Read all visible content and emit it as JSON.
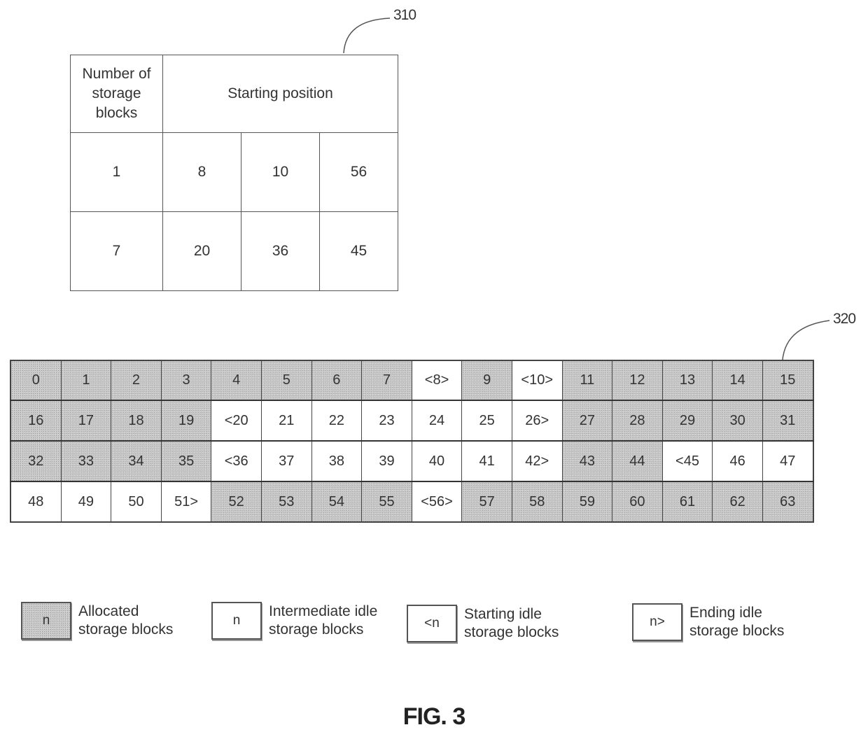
{
  "figure": {
    "caption": "FIG. 3",
    "ref_table": "310",
    "ref_grid": "320"
  },
  "table310": {
    "header_left_lines": [
      "Number of",
      "storage",
      "blocks"
    ],
    "header_right": "Starting position",
    "rows": [
      {
        "count": "1",
        "positions": [
          "8",
          "10",
          "56"
        ]
      },
      {
        "count": "7",
        "positions": [
          "20",
          "36",
          "45"
        ]
      }
    ]
  },
  "grid320": {
    "columns": 16,
    "cells": [
      {
        "label": "0",
        "state": "allocated"
      },
      {
        "label": "1",
        "state": "allocated"
      },
      {
        "label": "2",
        "state": "allocated"
      },
      {
        "label": "3",
        "state": "allocated"
      },
      {
        "label": "4",
        "state": "allocated"
      },
      {
        "label": "5",
        "state": "allocated"
      },
      {
        "label": "6",
        "state": "allocated"
      },
      {
        "label": "7",
        "state": "allocated"
      },
      {
        "label": "<8>",
        "state": "idle"
      },
      {
        "label": "9",
        "state": "allocated"
      },
      {
        "label": "<10>",
        "state": "idle"
      },
      {
        "label": "11",
        "state": "allocated"
      },
      {
        "label": "12",
        "state": "allocated"
      },
      {
        "label": "13",
        "state": "allocated"
      },
      {
        "label": "14",
        "state": "allocated"
      },
      {
        "label": "15",
        "state": "allocated"
      },
      {
        "label": "16",
        "state": "allocated"
      },
      {
        "label": "17",
        "state": "allocated"
      },
      {
        "label": "18",
        "state": "allocated"
      },
      {
        "label": "19",
        "state": "allocated"
      },
      {
        "label": "<20",
        "state": "idle"
      },
      {
        "label": "21",
        "state": "idle"
      },
      {
        "label": "22",
        "state": "idle"
      },
      {
        "label": "23",
        "state": "idle"
      },
      {
        "label": "24",
        "state": "idle"
      },
      {
        "label": "25",
        "state": "idle"
      },
      {
        "label": "26>",
        "state": "idle"
      },
      {
        "label": "27",
        "state": "allocated"
      },
      {
        "label": "28",
        "state": "allocated"
      },
      {
        "label": "29",
        "state": "allocated"
      },
      {
        "label": "30",
        "state": "allocated"
      },
      {
        "label": "31",
        "state": "allocated"
      },
      {
        "label": "32",
        "state": "allocated"
      },
      {
        "label": "33",
        "state": "allocated"
      },
      {
        "label": "34",
        "state": "allocated"
      },
      {
        "label": "35",
        "state": "allocated"
      },
      {
        "label": "<36",
        "state": "idle"
      },
      {
        "label": "37",
        "state": "idle"
      },
      {
        "label": "38",
        "state": "idle"
      },
      {
        "label": "39",
        "state": "idle"
      },
      {
        "label": "40",
        "state": "idle"
      },
      {
        "label": "41",
        "state": "idle"
      },
      {
        "label": "42>",
        "state": "idle"
      },
      {
        "label": "43",
        "state": "allocated"
      },
      {
        "label": "44",
        "state": "allocated"
      },
      {
        "label": "<45",
        "state": "idle"
      },
      {
        "label": "46",
        "state": "idle"
      },
      {
        "label": "47",
        "state": "idle"
      },
      {
        "label": "48",
        "state": "idle"
      },
      {
        "label": "49",
        "state": "idle"
      },
      {
        "label": "50",
        "state": "idle"
      },
      {
        "label": "51>",
        "state": "idle"
      },
      {
        "label": "52",
        "state": "allocated"
      },
      {
        "label": "53",
        "state": "allocated"
      },
      {
        "label": "54",
        "state": "allocated"
      },
      {
        "label": "55",
        "state": "allocated"
      },
      {
        "label": "<56>",
        "state": "idle"
      },
      {
        "label": "57",
        "state": "allocated"
      },
      {
        "label": "58",
        "state": "allocated"
      },
      {
        "label": "59",
        "state": "allocated"
      },
      {
        "label": "60",
        "state": "allocated"
      },
      {
        "label": "61",
        "state": "allocated"
      },
      {
        "label": "62",
        "state": "allocated"
      },
      {
        "label": "63",
        "state": "allocated"
      }
    ]
  },
  "legend": [
    {
      "swatch": "n",
      "state": "allocated",
      "lines": [
        "Allocated",
        "storage blocks"
      ]
    },
    {
      "swatch": "n",
      "state": "idle",
      "lines": [
        "Intermediate idle",
        "storage blocks"
      ]
    },
    {
      "swatch": "<n",
      "state": "idle",
      "lines": [
        "Starting idle",
        "storage blocks"
      ]
    },
    {
      "swatch": "n>",
      "state": "idle",
      "lines": [
        "Ending idle",
        "storage blocks"
      ]
    }
  ]
}
